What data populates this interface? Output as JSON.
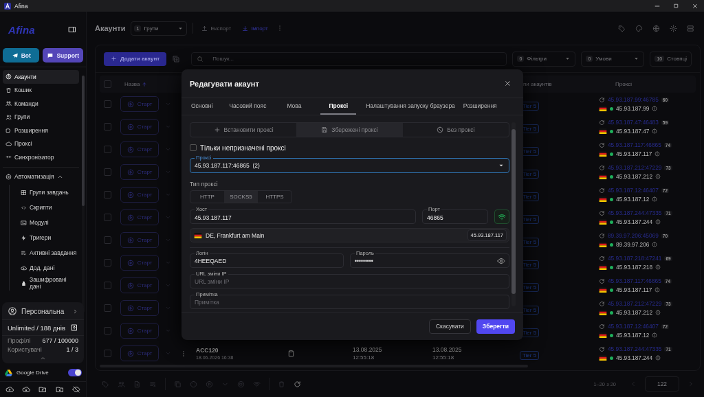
{
  "window": {
    "title": "Afina"
  },
  "sidebar": {
    "logo": "Afina",
    "buttons": [
      {
        "kind": "telegram",
        "label": "Bot"
      },
      {
        "kind": "support",
        "label": "Support"
      }
    ],
    "items": [
      {
        "kind": "accounts",
        "label": "Акаунти",
        "selected": true
      },
      {
        "kind": "trash",
        "label": "Кошик",
        "selected": false
      },
      {
        "kind": "teams",
        "label": "Команди",
        "selected": false
      },
      {
        "kind": "groups",
        "label": "Групи",
        "selected": false
      },
      {
        "kind": "extensions",
        "label": "Розширення",
        "selected": false
      },
      {
        "kind": "proxy",
        "label": "Проксі",
        "selected": false
      },
      {
        "kind": "sync",
        "label": "Синхронізатор",
        "selected": false
      }
    ],
    "automation": {
      "label": "Автоматизація",
      "expanded": true,
      "children": [
        {
          "kind": "taskgroups",
          "label": "Групи завдань",
          "selected": false
        },
        {
          "kind": "scripts",
          "label": "Скрипти",
          "selected": false
        },
        {
          "kind": "modules",
          "label": "Модулі",
          "selected": false
        },
        {
          "kind": "triggers",
          "label": "Тригери",
          "selected": false
        },
        {
          "kind": "tasks",
          "label": "Активні завдання",
          "selected": false
        },
        {
          "kind": "data",
          "label": "Дод. дані",
          "selected": false
        },
        {
          "kind": "encrypted",
          "label": "Зашифровані дані",
          "selected": false
        }
      ]
    },
    "plan": {
      "name": "Персональна",
      "license": "Unlimited / 188 днів",
      "stats": [
        {
          "label": "Профілі",
          "value": "677 / 100000"
        },
        {
          "label": "Користувачі",
          "value": "1 / 3"
        }
      ]
    },
    "drive": {
      "label": "Google Drive",
      "on": true
    }
  },
  "header": {
    "title": "Акаунти",
    "groups": {
      "count": "1",
      "label": "Групи"
    },
    "actions": [
      {
        "kind": "export",
        "label": "Експорт",
        "disabled": true
      },
      {
        "kind": "import",
        "label": "Імпорт",
        "disabled": false
      }
    ]
  },
  "toolbar": {
    "add_button": "Додати акаунт",
    "search": {
      "placeholder": "Пошук..."
    },
    "filters": [
      {
        "count": "0",
        "label": "Фільтри",
        "dropdown": true
      },
      {
        "count": "0",
        "label": "Умови",
        "dropdown": true
      },
      {
        "count": "10",
        "label": "Стовпці",
        "dropdown": false
      }
    ]
  },
  "table": {
    "select_all": {
      "checked": false
    },
    "columns": [
      {
        "label": "Назва",
        "sorted": true
      },
      {
        "label": "пи акаунтів",
        "sorted": false
      },
      {
        "label": "Проксі",
        "sorted": false
      }
    ],
    "rows": [
      {
        "checked": false,
        "action": "Старт",
        "tier": "Tier 5",
        "proxy": "45.93.187.99:46785",
        "score": "60",
        "ip": "45.93.187.99"
      },
      {
        "checked": false,
        "action": "Старт",
        "tier": "Tier 5",
        "proxy": "45.93.187.47:46483",
        "score": "59",
        "ip": "45.93.187.47"
      },
      {
        "checked": false,
        "action": "Старт",
        "tier": "Tier 5",
        "proxy": "45.93.187.117:46865",
        "score": "74",
        "ip": "45.93.187.117"
      },
      {
        "checked": false,
        "action": "Старт",
        "tier": "Tier 5",
        "proxy": "45.93.187.212:47229",
        "score": "73",
        "ip": "45.93.187.212"
      },
      {
        "checked": false,
        "action": "Старт",
        "tier": "Tier 5",
        "proxy": "45.93.187.12:46407",
        "score": "72",
        "ip": "45.93.187.12"
      },
      {
        "checked": false,
        "action": "Старт",
        "tier": "Tier 5",
        "proxy": "45.93.187.244:47335",
        "score": "71",
        "ip": "45.93.187.244"
      },
      {
        "checked": false,
        "action": "Старт",
        "tier": "Tier 5",
        "proxy": "89.39.97.206:45069",
        "score": "70",
        "ip": "89.39.97.206"
      },
      {
        "checked": false,
        "action": "Старт",
        "tier": "Tier 5",
        "proxy": "45.93.187.218:47241",
        "score": "69",
        "ip": "45.93.187.218"
      },
      {
        "checked": false,
        "action": "Старт",
        "tier": "Tier 5",
        "proxy": "45.93.187.117:46865",
        "score": "74",
        "ip": "45.93.187.117"
      },
      {
        "checked": false,
        "action": "Старт",
        "tier": "Tier 5",
        "proxy": "45.93.187.212:47229",
        "score": "73",
        "ip": "45.93.187.212"
      },
      {
        "checked": false,
        "action": "Старт",
        "tier": "Tier 5",
        "proxy": "45.93.187.12:46407",
        "score": "72",
        "ip": "45.93.187.12"
      },
      {
        "checked": false,
        "action": "Старт",
        "name": "ACC120",
        "created": "18.06.2026 16:38",
        "date_1": {
          "day": "13.08.2025",
          "time": "12:55:18"
        },
        "date_2": {
          "day": "13.08.2025",
          "time": "12:55:18"
        },
        "tier": "Tier 5",
        "proxy": "45.93.187.244:47335",
        "score": "71",
        "ip": "45.93.187.244"
      }
    ]
  },
  "footer": {
    "range": "1–20 з 20",
    "page": "122"
  },
  "modal": {
    "title": "Редагувати акаунт",
    "tabs": [
      {
        "label": "Основні",
        "selected": false
      },
      {
        "label": "Часовий пояс",
        "selected": false
      },
      {
        "label": "Мова",
        "selected": false
      },
      {
        "label": "Проксі",
        "selected": true
      },
      {
        "label": "Налаштування запуску браузера",
        "selected": false
      },
      {
        "label": "Розширення",
        "selected": false
      }
    ],
    "sources": [
      {
        "kind": "add",
        "label": "Встановити проксі",
        "selected": false
      },
      {
        "kind": "saved",
        "label": "Збережені проксі",
        "selected": true
      },
      {
        "kind": "none",
        "label": "Без проксі",
        "selected": false
      }
    ],
    "unassigned_only": {
      "label": "Тільки непризначені проксі",
      "checked": false
    },
    "proxy_select": {
      "label": "Проксі",
      "value": "45.93.187.117:46865  (2)"
    },
    "type": {
      "label": "Тип проксі",
      "options": [
        {
          "label": "HTTP",
          "selected": false
        },
        {
          "label": "SOCKS5",
          "selected": true
        },
        {
          "label": "HTTPS",
          "selected": false
        }
      ]
    },
    "host": {
      "label": "Хост",
      "value": "45.93.187.117"
    },
    "port": {
      "label": "Порт",
      "value": "46865"
    },
    "geo": {
      "location": "DE, Frankfurt am Main",
      "ip": "45.93.187.117"
    },
    "login": {
      "label": "Логін",
      "value": "4HEEQAED"
    },
    "password": {
      "label": "Пароль",
      "value": "•••••••••"
    },
    "ip_change_url": {
      "label": "URL зміни IP",
      "placeholder": "URL зміни IP"
    },
    "note": {
      "label": "Примітка",
      "placeholder": "Примітка"
    },
    "buttons": [
      {
        "kind": "cancel",
        "label": "Скасувати"
      },
      {
        "kind": "save",
        "label": "Зберегти"
      }
    ]
  }
}
